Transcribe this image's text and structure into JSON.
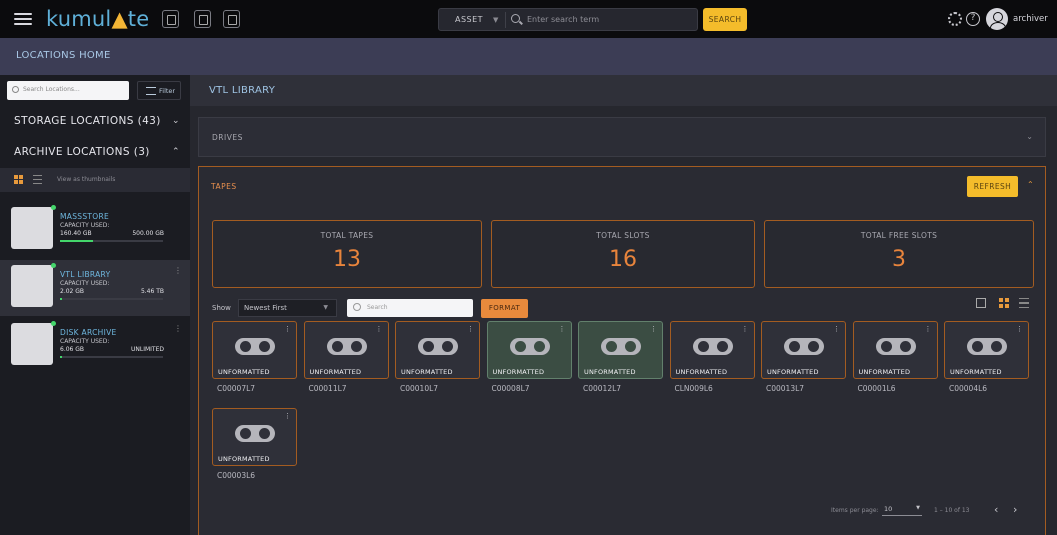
{
  "app": {
    "logo_text": "kumulate",
    "user": "archiver"
  },
  "search": {
    "scope": "ASSET",
    "placeholder": "Enter search term",
    "button": "SEARCH"
  },
  "header": {
    "title": "LOCATIONS HOME"
  },
  "sidebar": {
    "search_placeholder": "Search Locations...",
    "filter_label": "Filter",
    "storage_locations": "STORAGE LOCATIONS (43)",
    "archive_locations": "ARCHIVE LOCATIONS (3)",
    "view_label": "View as thumbnails",
    "locations": [
      {
        "name": "MASSSTORE",
        "cap_label": "CAPACITY USED:",
        "used": "160.40 GB",
        "total": "500.00 GB",
        "fill": 0.32
      },
      {
        "name": "VTL LIBRARY",
        "cap_label": "CAPACITY USED:",
        "used": "2.02 GB",
        "total": "5.46 TB",
        "fill": 0.01
      },
      {
        "name": "DISK ARCHIVE",
        "cap_label": "CAPACITY USED:",
        "used": "6.06 GB",
        "total": "UNLIMITED",
        "fill": 0.01
      }
    ]
  },
  "main": {
    "title": "VTL LIBRARY",
    "drives_label": "DRIVES",
    "tapes_label": "TAPES",
    "refresh": "REFRESH",
    "stats": [
      {
        "label": "TOTAL TAPES",
        "value": "13"
      },
      {
        "label": "TOTAL SLOTS",
        "value": "16"
      },
      {
        "label": "TOTAL FREE SLOTS",
        "value": "3"
      }
    ],
    "show_label": "Show",
    "sort": "Newest First",
    "tape_search_placeholder": "Search",
    "format": "FORMAT",
    "tapes": [
      {
        "id": "C00007L7",
        "status": "UNFORMATTED",
        "highlight": false
      },
      {
        "id": "C00011L7",
        "status": "UNFORMATTED",
        "highlight": false
      },
      {
        "id": "C00010L7",
        "status": "UNFORMATTED",
        "highlight": false
      },
      {
        "id": "C00008L7",
        "status": "UNFORMATTED",
        "highlight": true
      },
      {
        "id": "C00012L7",
        "status": "UNFORMATTED",
        "highlight": true
      },
      {
        "id": "CLN009L6",
        "status": "UNFORMATTED",
        "highlight": false
      },
      {
        "id": "C00013L7",
        "status": "UNFORMATTED",
        "highlight": false
      },
      {
        "id": "C00001L6",
        "status": "UNFORMATTED",
        "highlight": false
      },
      {
        "id": "C00004L6",
        "status": "UNFORMATTED",
        "highlight": false
      },
      {
        "id": "C00003L6",
        "status": "UNFORMATTED",
        "highlight": false
      }
    ],
    "pager": {
      "label": "Items per page:",
      "size": "10",
      "range": "1 – 10 of 13"
    }
  }
}
